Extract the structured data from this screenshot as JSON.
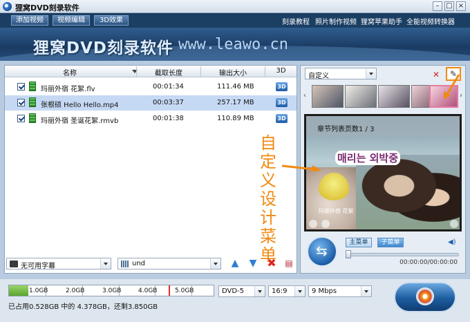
{
  "window": {
    "title": "狸窝DVD刻录软件"
  },
  "toolbar": {
    "add_video": "添加视频",
    "edit_video": "视频编辑",
    "effect_3d": "3D效果",
    "links": [
      "刻录教程",
      "照片制作视频",
      "狸窝苹果助手",
      "全能视频转换器"
    ]
  },
  "banner": {
    "brand": "狸窝DVD刻录软件",
    "url": "www.leawo.cn"
  },
  "file_list": {
    "columns": [
      "名称",
      "截取长度",
      "输出大小",
      "3D"
    ],
    "rows": [
      {
        "name": "玛丽外宿 花絮.flv",
        "duration": "00:01:34",
        "size": "111.46 MB",
        "checked": true,
        "selected": false
      },
      {
        "name": "张根硕 Hello Hello.mp4",
        "duration": "00:03:37",
        "size": "257.17 MB",
        "checked": true,
        "selected": true
      },
      {
        "name": "玛丽外宿 圣诞花絮.rmvb",
        "duration": "00:01:38",
        "size": "110.89 MB",
        "checked": true,
        "selected": false
      }
    ],
    "badge_3d": "3D",
    "subtitle_select": "无可用字幕",
    "audio_select": "und"
  },
  "menu_panel": {
    "template_select": "自定义",
    "chapter_page": "章节列表页数1 / 3",
    "logo_text": "매리는 외박중",
    "caption": "玛丽外宿 花絮"
  },
  "annotation": {
    "text": "自定义设计菜单",
    "color": "#f08a12"
  },
  "player": {
    "main_menu": "主菜单",
    "sub_menu": "子菜单",
    "timecode": "00:00:00/00:00:00"
  },
  "capacity": {
    "scale_labels": [
      "1.0GB",
      "2.0GB",
      "3.0GB",
      "4.0GB",
      "5.0GB"
    ],
    "used_gb": 0.528,
    "total_gb": 4.378,
    "limit_gb": 4.378,
    "status": "已占用0.528GB 中的 4.378GB，还剩3.850GB",
    "disc_type": "DVD-5",
    "aspect": "16:9",
    "bitrate": "9 Mbps"
  },
  "colors": {
    "accent": "#1c5ea9",
    "banner": "#1a3b63"
  }
}
